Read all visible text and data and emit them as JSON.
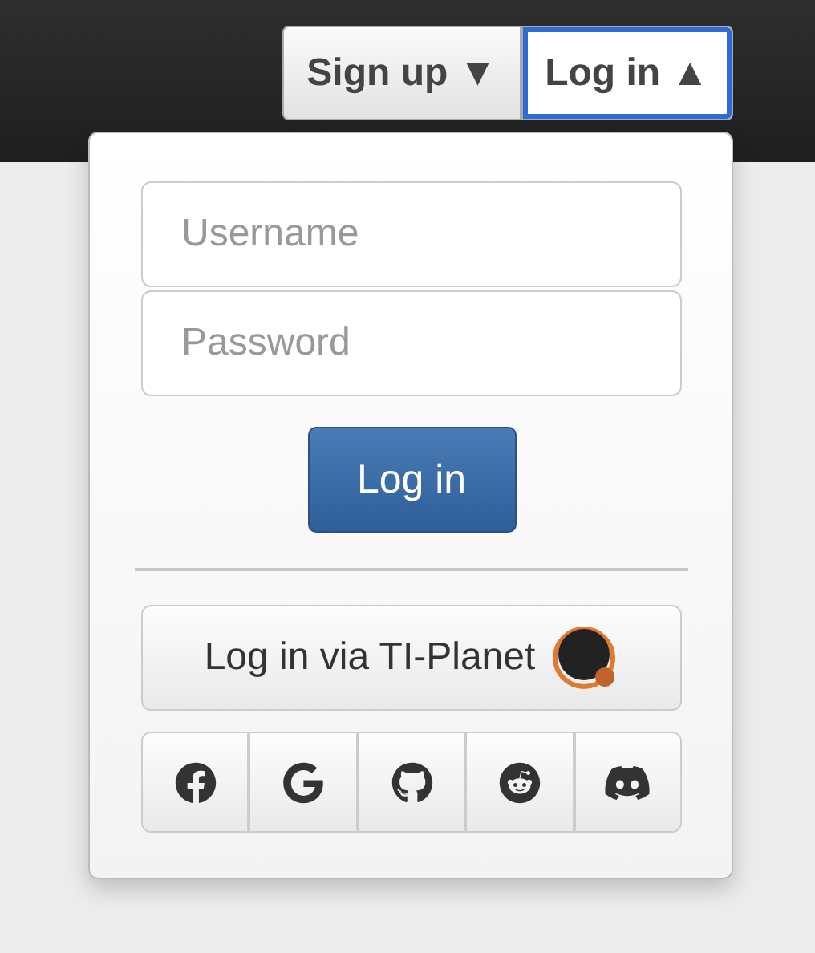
{
  "nav_buttons": [
    {
      "label": "Sign up",
      "arrow": "▼",
      "selected": false
    },
    {
      "label": "Log in",
      "arrow": "▲",
      "selected": true
    }
  ],
  "login_form": {
    "username": {
      "placeholder": "Username"
    },
    "password": {
      "placeholder": "Password"
    },
    "submit": "Log in",
    "external_login": "Log in via TI-Planet",
    "social_buttons": [
      {
        "kind": "facebook"
      },
      {
        "kind": "google"
      },
      {
        "kind": "github"
      },
      {
        "kind": "reddit"
      },
      {
        "kind": "discord"
      }
    ]
  }
}
